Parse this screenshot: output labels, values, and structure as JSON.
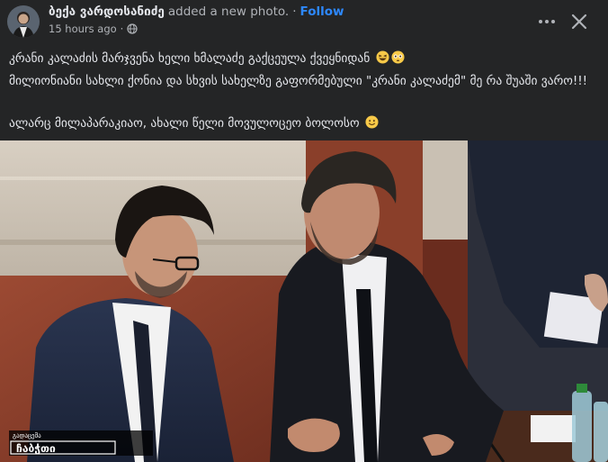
{
  "post": {
    "author": "ბექა ვარდოსანიძე",
    "action": "added a new photo.",
    "separator": "·",
    "follow_label": "Follow",
    "timestamp": "15 hours ago",
    "visibility_icon": "globe-icon",
    "paragraphs": [
      "კრანი კალაძის მარჯვენა ხელი ხმალაძე გაქცეულა ქვეყნიდან",
      "მილიონიანი სახლი ქონია და სხვის სახელზე გაფორმებული \"კრანი კალაძემ\" მე რა შუაში ვარო!!!",
      "ალარც მილაპარაკიაო, ახალი წელი მოვულოცეო ბოლოსო"
    ],
    "emojis": [
      "laughing-squint-face",
      "flushed-face",
      "smiling-face"
    ]
  },
  "photo": {
    "watermark_small": "გადაცემა",
    "watermark_big": "ჩაბჭთი"
  },
  "colors": {
    "background": "#242526",
    "primary_text": "#e4e6eb",
    "secondary_text": "#b0b3b8",
    "link": "#2d88ff"
  }
}
